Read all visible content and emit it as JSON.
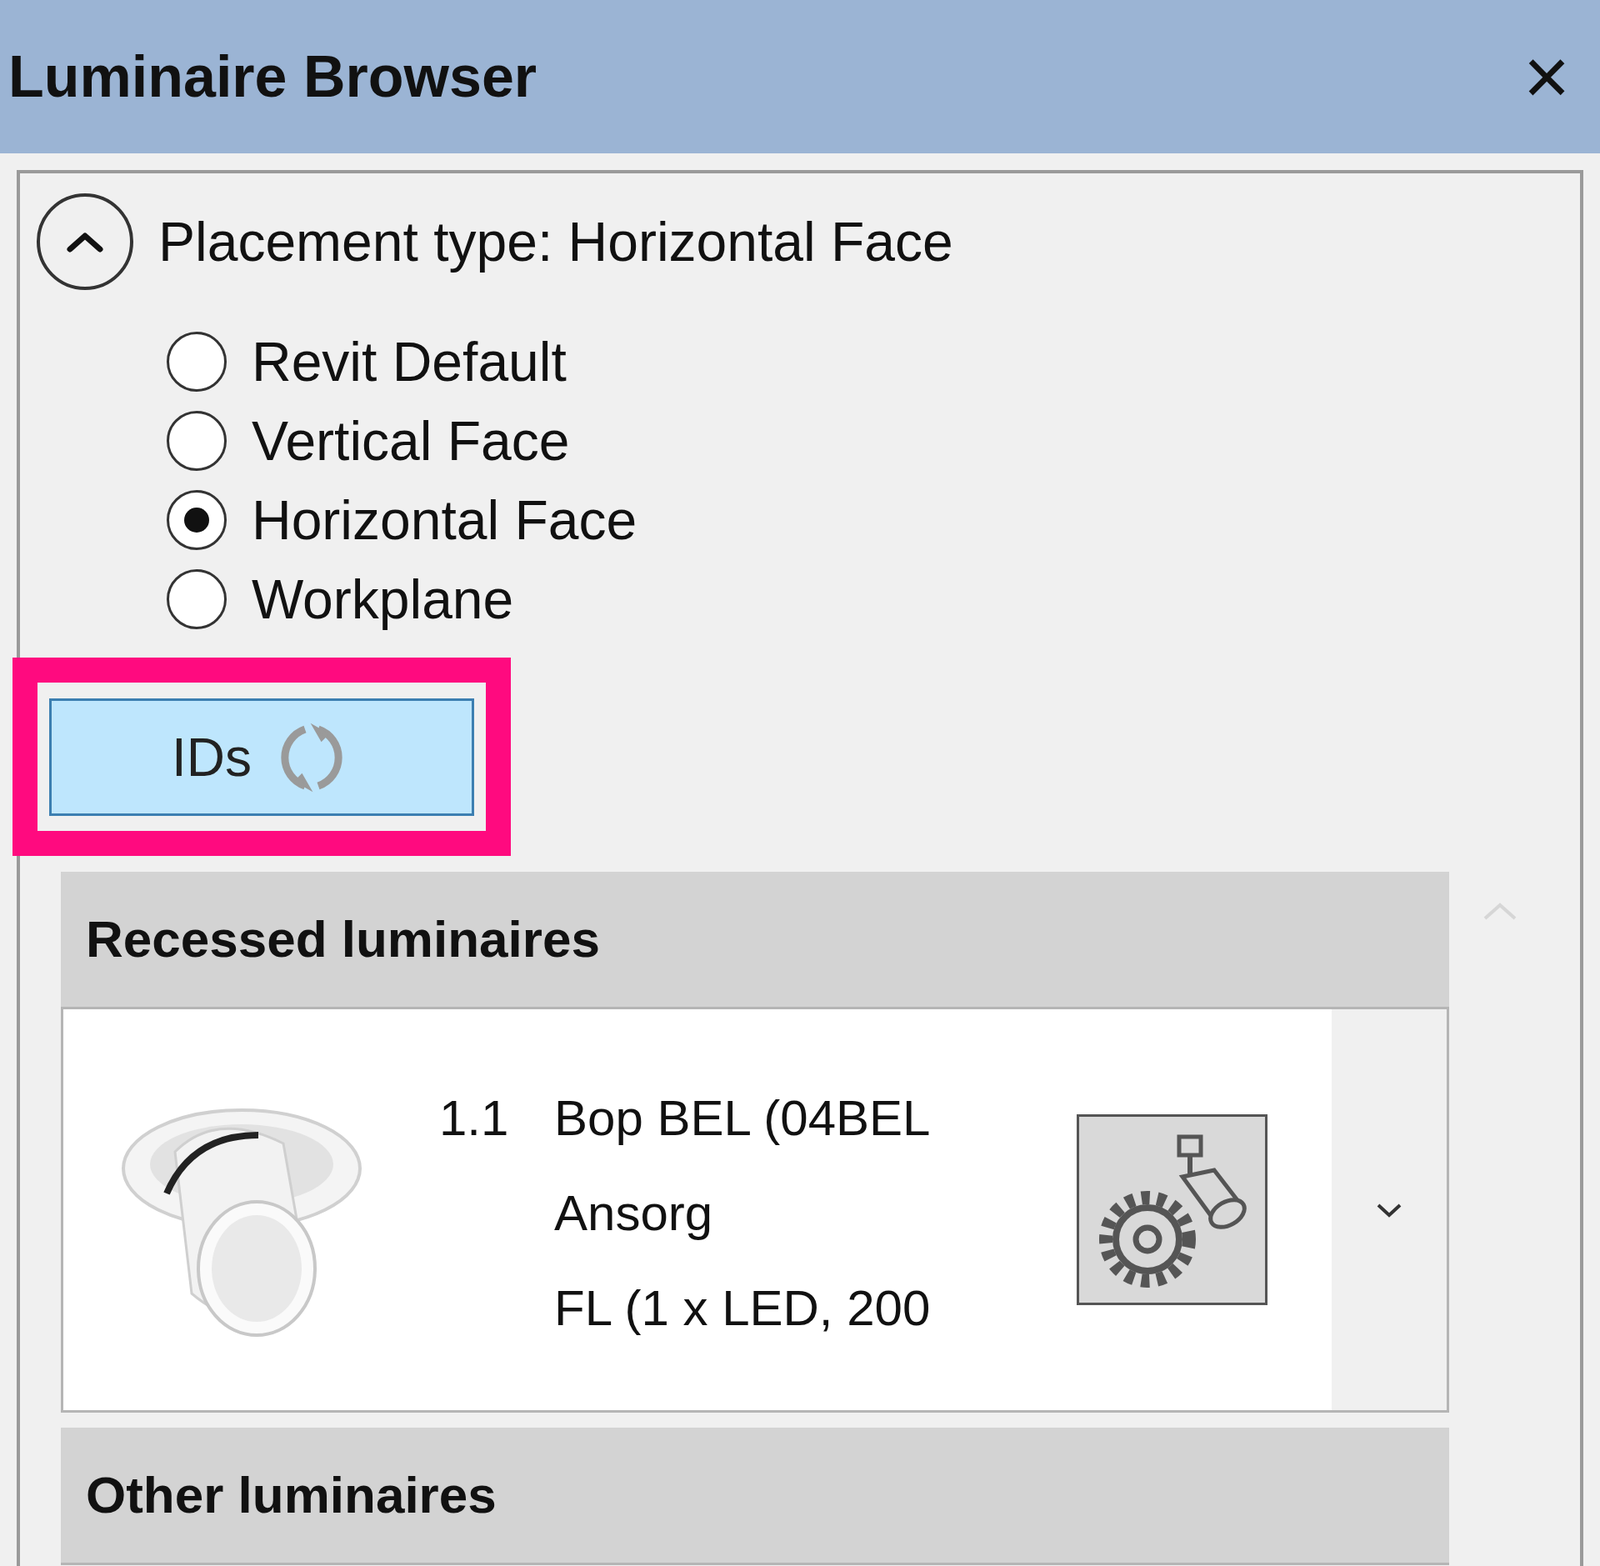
{
  "window": {
    "title": "Luminaire Browser",
    "close": "×"
  },
  "placement": {
    "title": "Placement type: Horizontal Face",
    "expanded": true,
    "options": [
      {
        "label": "Revit Default",
        "selected": false
      },
      {
        "label": "Vertical Face",
        "selected": false
      },
      {
        "label": "Horizontal Face",
        "selected": true
      },
      {
        "label": "Workplane",
        "selected": false
      }
    ]
  },
  "ids_button": {
    "label": "IDs",
    "annotated": true
  },
  "groups": [
    {
      "title": "Recessed luminaires",
      "items": [
        {
          "number": "1.1",
          "lines": [
            "Bop BEL (04BEL",
            "Ansorg",
            "FL (1 x LED, 200"
          ],
          "expanded": false
        }
      ]
    },
    {
      "title": "Other luminaires",
      "items": []
    }
  ]
}
